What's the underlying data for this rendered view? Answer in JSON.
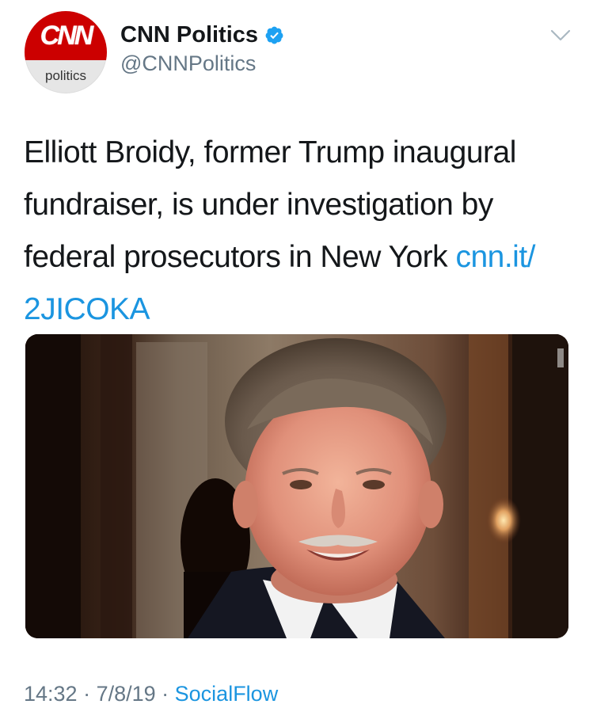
{
  "account": {
    "avatar_logo": "CNN",
    "avatar_sub": "politics",
    "display_name": "CNN Politics",
    "handle": "@CNNPolitics",
    "verified": true
  },
  "tweet": {
    "text": "Elliott Broidy, former Trump inaugural fundraiser, is under investigation by federal prosecutors in New York ",
    "link_part1": "cnn.it/",
    "link_part2": "2JICOKA"
  },
  "meta": {
    "time": "14:32",
    "separator1": " · ",
    "date": "7/8/19",
    "separator2": " · ",
    "source": "SocialFlow"
  },
  "icons": {
    "verified": "verified-badge-icon",
    "caret": "chevron-down-icon"
  },
  "colors": {
    "brand_red": "#cc0000",
    "link_blue": "#1b95e0",
    "secondary_gray": "#657786",
    "text_black": "#14171a"
  }
}
